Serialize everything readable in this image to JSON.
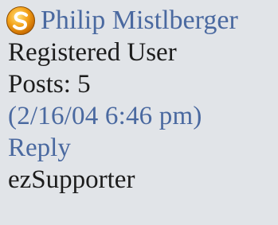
{
  "author": {
    "name": "Philip Mistlberger",
    "role": "Registered User",
    "posts": "Posts: 5",
    "avatar_icon": "ezsupporter-badge-icon"
  },
  "post": {
    "timestamp": "(2/16/04 6:46 pm)",
    "reply_label": "Reply"
  },
  "footer": {
    "rank": "ezSupporter"
  },
  "colors": {
    "background": "#e1e4e8",
    "link": "#4a69a0",
    "text": "#1c1c1c"
  }
}
